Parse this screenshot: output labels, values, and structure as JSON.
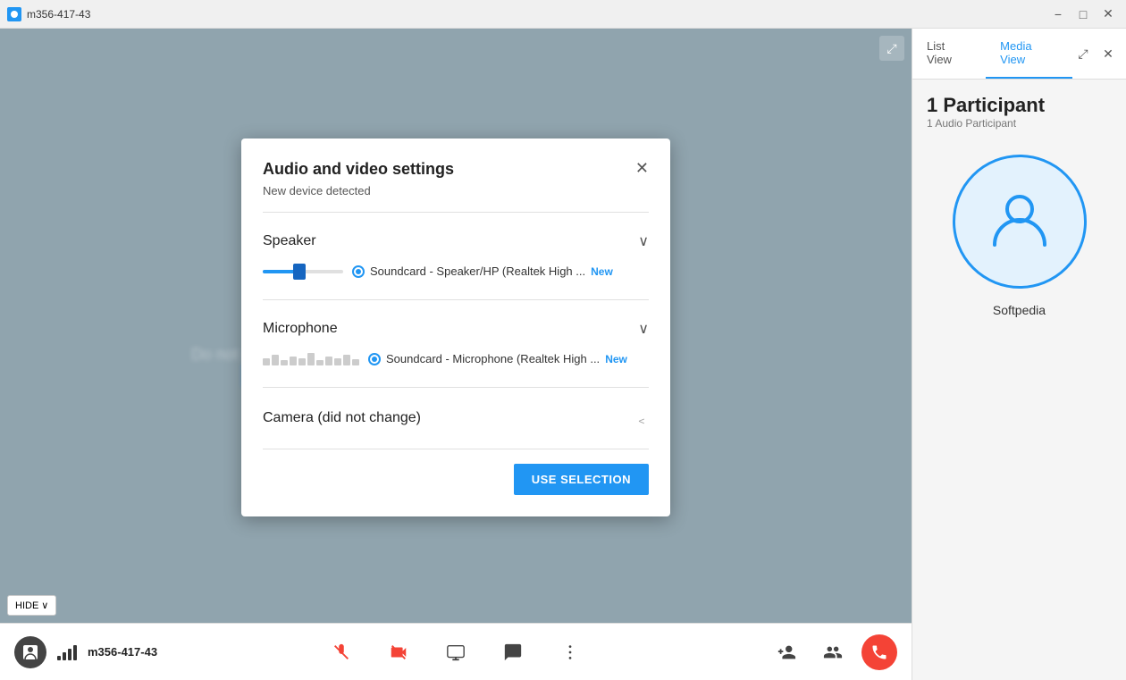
{
  "titleBar": {
    "title": "m356-417-43",
    "minimizeLabel": "−",
    "maximizeLabel": "□",
    "closeLabel": "✕"
  },
  "panel": {
    "listViewLabel": "List View",
    "mediaViewLabel": "Media View",
    "participantCount": "1 Participant",
    "participantSub": "1 Audio Participant",
    "participantName": "Softpedia"
  },
  "dialog": {
    "title": "Audio and video settings",
    "subtitle": "New device detected",
    "closeLabel": "✕",
    "speaker": {
      "label": "Speaker",
      "deviceName": "Soundcard - Speaker/HP (Realtek High ...",
      "newBadge": "New"
    },
    "microphone": {
      "label": "Microphone",
      "deviceName": "Soundcard - Microphone (Realtek High ...",
      "newBadge": "New"
    },
    "camera": {
      "label": "Camera (did not change)"
    },
    "useSelectionLabel": "USE SELECTION"
  },
  "bottomBar": {
    "hideLabel": "HIDE",
    "meetingId": "m356-417-43",
    "controls": {
      "muteLabel": "Mute",
      "videoLabel": "Video",
      "screenLabel": "Screen",
      "chatLabel": "Chat",
      "moreLabel": "More"
    }
  }
}
